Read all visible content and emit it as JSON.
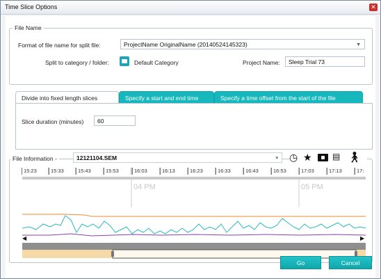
{
  "window": {
    "title": "Time Slice Options",
    "close_icon": "close-icon"
  },
  "file_name_section": {
    "legend": "File Name",
    "format_label": "Format of file name for split file:",
    "format_value": "ProjectName OriginalName (20140524145323)",
    "split_label": "Split to category / folder:",
    "category_value": "Default Category",
    "project_label": "Project Name:",
    "project_value": "Sleep Trial 73"
  },
  "tabs": [
    {
      "label": "Divide into fixed length slices",
      "active": true
    },
    {
      "label": "Specify a start and end time",
      "active": false
    },
    {
      "label": "Specify a time offset from the start of the file",
      "active": false
    }
  ],
  "slice": {
    "label": "Slice duration (minutes)",
    "value": "60"
  },
  "file_info": {
    "legend": "File Information -",
    "file_value": "12121104.SEM",
    "icons": [
      "clock-icon",
      "star-icon",
      "id-card-icon",
      "book-icon",
      "walking-person-icon"
    ]
  },
  "timeline": {
    "ticks": [
      "15:23",
      "15:33",
      "15:43",
      "15:53",
      "16:03",
      "16:13",
      "16:23",
      "16:33",
      "16:43",
      "16:53",
      "17:03",
      "17:13",
      "17:"
    ],
    "hour_labels": [
      "04 PM",
      "05 PM"
    ],
    "colors": {
      "orange": "#f08a2c",
      "teal": "#2ab7c5",
      "purple": "#8e3fae"
    }
  },
  "buttons": {
    "go": "Go",
    "cancel": "Cancel"
  }
}
